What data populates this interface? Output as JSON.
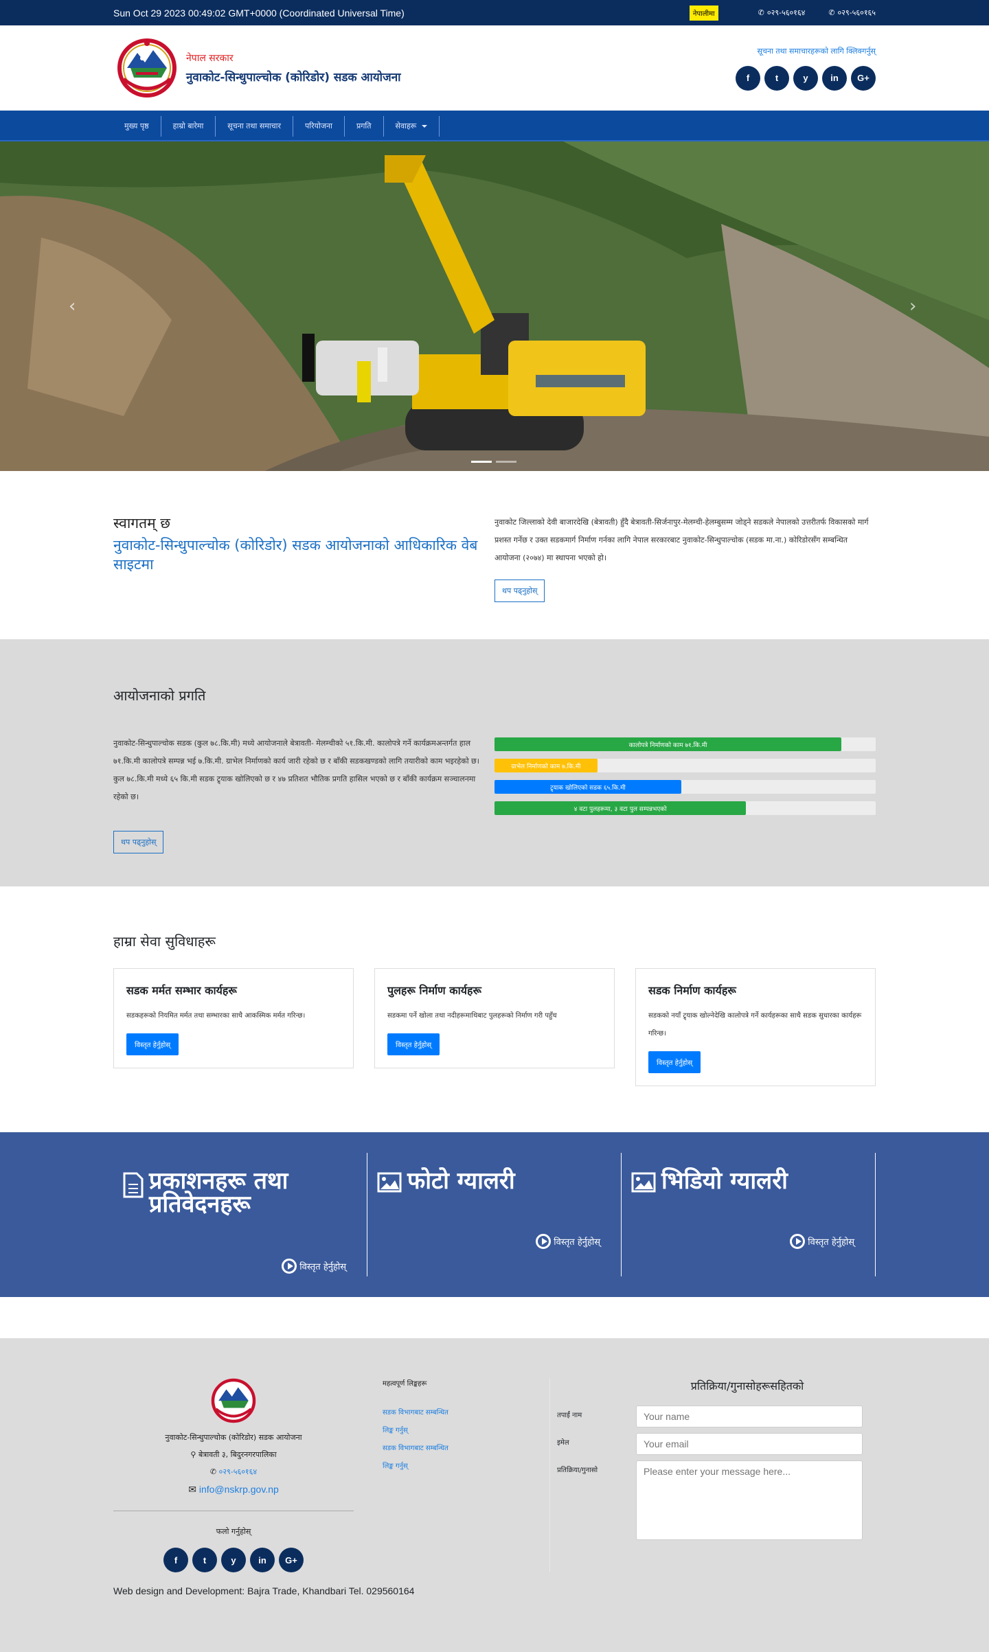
{
  "topbar": {
    "date": "Sun Oct 29 2023 00:49:02 GMT+0000 (Coordinated Universal Time)",
    "badge": "नेपालीमा",
    "phone1": "०२९-५६०१६४",
    "phone2": "०२९-५६०१६५"
  },
  "header": {
    "subtitle": "नेपाल सरकार",
    "title": "नुवाकोट-सिन्धुपाल्चोक (कोरिडोर) सडक आयोजना",
    "right_link": "सूचना तथा समाचारहरूको लागि क्लिक्गर्नुस्",
    "social": [
      "f",
      "t",
      "y",
      "in",
      "G+"
    ]
  },
  "nav": {
    "items": [
      "मुख्य पृष्ठ",
      "हाम्रो बारेमा",
      "सूचना तथा समाचार",
      "परियोजना",
      "प्रगति",
      "सेवाहरू"
    ]
  },
  "hero": {
    "prev": "‹",
    "next": "›"
  },
  "intro": {
    "h1": "स्वागतम् छ",
    "h2": "नुवाकोट-सिन्धुपाल्चोक (कोरिडोर) सडक आयोजनाको आधिकारिक वेब साइटमा",
    "para": "नुवाकोट जिल्लाको देवी बाजारदेखि (बेत्रावती) हुँदै बेत्रावती-सिर्जनापुर-मेलम्ची-हेलम्बुसम्म जोड्ने सडकले नेपालको उत्तरीतर्फ विकासको मार्ग प्रशस्त गर्नेछ र उक्त सडकमार्ग निर्माण गर्नका लागि नेपाल सरकारबाट नुवाकोट-सिन्धुपाल्चोक (सडक मा.ना.) कोरिडोरसँग सम्बन्धित आयोजना (२०७४) मा स्थापना भएको हो।",
    "button": "थप पढ्नुहोस्"
  },
  "progress": {
    "title": "आयोजनाको प्रगति",
    "para": "नुवाकोट-सिन्धुपाल्चोक सडक (कुल ७८.कि.मी) मध्ये आयोजनाले बेत्रावती- मेलम्चीको ५१.कि.मी. कालोपत्रे गर्ने कार्यक्रमअन्तर्गत हाल ७१.कि.मी कालोपत्रे सम्पन्न भई ७.कि.मी. ग्राभेल निर्माणको कार्य जारी रहेको छ र बाँकी सडकखण्डको लागि तयारीको काम भइरहेको छ। कुल ७८.कि.मी मध्ये ६५ कि.मी सडक ट्र्याक खोलिएको छ र ४७ प्रतिशत भौतिक प्रगति हासिल भएको छ र बाँकी कार्यक्रम सञ्चालनमा रहेको छ।",
    "button": "थप पढ्नुहोस्",
    "bars": [
      {
        "label": "कालोपत्रे निर्माणको काम ७१.कि.मी",
        "value": 91,
        "color": "#28a745"
      },
      {
        "label": "ग्राभेल निर्माणको काम ७.कि.मी",
        "value": 27,
        "color": "#ffc107"
      },
      {
        "label": "ट्र्याक खोलिएको सडक ६५.कि.मी",
        "value": 49,
        "color": "#007bff"
      },
      {
        "label": "४ वटा पुलहरूमा, ३ वटा पुल सम्पन्नभएको",
        "value": 66,
        "color": "#28a745"
      }
    ]
  },
  "services": {
    "title": "हाम्रा सेवा सुविधाहरू",
    "cards": [
      {
        "title": "सडक मर्मत सम्भार कार्यहरू",
        "text": "सडकहरूको नियमित मर्मत तथा सम्भारका साथै आकस्मिक मर्मत गरिन्छ।",
        "button": "विस्तृत हेर्नुहोस्"
      },
      {
        "title": "पुलहरू निर्माण कार्यहरू",
        "text": "सडकमा पर्ने खोला तथा नदीहरूमाथिबाट पुलहरूको निर्माण गरी पहुँच",
        "button": "विस्तृत हेर्नुहोस्"
      },
      {
        "title": "सडक निर्माण कार्यहरू",
        "text": "सडकको नयाँ ट्र्याक खोल्नेदेखि कालोपत्रे गर्ने कार्यहरूका साथै सडक सुधारका कार्यहरू गरिन्छ।",
        "button": "विस्तृत हेर्नुहोस्"
      }
    ]
  },
  "band": {
    "cols": [
      {
        "title": "प्रकाशनहरू तथा प्रतिवेदनहरू",
        "more": "विस्तृत हेर्नुहोस्",
        "icon": "document-icon"
      },
      {
        "title": "फोटो ग्यालरी",
        "more": "विस्तृत हेर्नुहोस्",
        "icon": "image-icon"
      },
      {
        "title": "भिडियो ग्यालरी",
        "more": "विस्तृत हेर्नुहोस्",
        "icon": "image-icon"
      }
    ]
  },
  "footer": {
    "name": "नुवाकोट-सिन्धुपाल्चोक (कोरिडोर) सडक आयोजना",
    "address": "बेत्रावती ३, बिदुरनगरपालिका",
    "phone": "०२९-५६०१६४",
    "email": "info@nskrp.gov.np",
    "follow": "फलो गर्नुहोस्",
    "links_title": "महत्वपूर्ण लिङ्कहरू",
    "links": [
      "सडक विभागबाट सम्बन्धित",
      "लिङ्क गर्नुस्",
      "सडक विभागबाट सम्बन्धित",
      "लिङ्क गर्नुस्"
    ],
    "form": {
      "title": "प्रतिक्रिया/गुनासोहरूसहितको",
      "name_label": "तपाईं नाम",
      "email_label": "इमेल",
      "msg_label": "प्रतिक्रिया/गुनासो",
      "name_ph": "Your name",
      "email_ph": "Your email",
      "msg_ph": "Please enter your message here..."
    },
    "credit": "Web design and Development: Bajra Trade, Khandbari Tel. 029560164"
  }
}
